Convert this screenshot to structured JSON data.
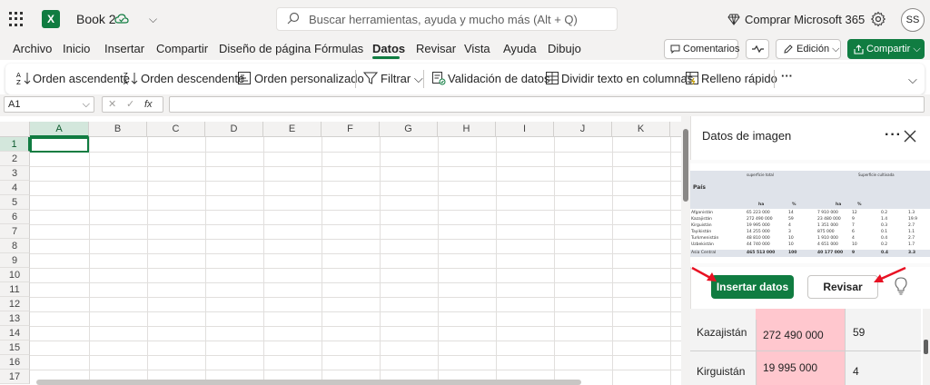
{
  "titlebar": {
    "app_logo": "X",
    "book_title": "Book 2",
    "search_placeholder": "Buscar herramientas, ayuda y mucho más (Alt + Q)",
    "buy_label": "Comprar Microsoft 365",
    "avatar_initials": "SS"
  },
  "tabs": [
    "Archivo",
    "Inicio",
    "Insertar",
    "Compartir",
    "Diseño de página",
    "Fórmulas",
    "Datos",
    "Revisar",
    "Vista",
    "Ayuda",
    "Dibujo"
  ],
  "active_tab": "Datos",
  "topbar": {
    "comments_label": "Comentarios",
    "edit_label": "Edición",
    "share_label": "Compartir"
  },
  "ribbon": {
    "sort_asc": "Orden ascendente",
    "sort_desc": "Orden descendente",
    "sort_custom": "Orden personalizado",
    "filter": "Filtrar",
    "validation": "Validación de datos",
    "text_to_columns": "Dividir texto en columnas",
    "flash_fill": "Relleno rápido",
    "more": "···"
  },
  "formula_bar": {
    "name_box": "A1",
    "cancel": "✕",
    "enter": "✓",
    "fx": "fx"
  },
  "grid": {
    "columns": [
      "A",
      "B",
      "C",
      "D",
      "E",
      "F",
      "G",
      "H",
      "I",
      "J",
      "K"
    ],
    "rows": [
      "1",
      "2",
      "3",
      "4",
      "5",
      "6",
      "7",
      "8",
      "9",
      "10",
      "11",
      "12",
      "13",
      "14",
      "15",
      "16",
      "17"
    ],
    "active_cell": "A1"
  },
  "panel": {
    "title": "Datos de imagen",
    "more": "···",
    "insert_label": "Insertar datos",
    "review_label": "Revisar",
    "rows": [
      {
        "country": "Kazajistán",
        "value": "272 490 000",
        "pct": "59"
      },
      {
        "country": "Kirguistán",
        "value": "19 995 000",
        "pct": "4"
      }
    ]
  },
  "thumbnail": {
    "header_pais": "País",
    "header_superficie": "superficie total",
    "header_cultivada": "Superficie cultivada",
    "unit_ha": "ha",
    "unit_pct": "%",
    "rows": [
      [
        "Afganistán",
        "65 223 000",
        "14",
        "7 910 000",
        "12",
        "0.2",
        "1.3"
      ],
      [
        "Kazajistán",
        "272 490 000",
        "59",
        "23 480 000",
        "9",
        "1.4",
        "19.9"
      ],
      [
        "Kirguistán",
        "19 995 000",
        "4",
        "1 351 000",
        "7",
        "0.3",
        "2.7"
      ],
      [
        "Tayikistán",
        "14 255 000",
        "3",
        "875 000",
        "6",
        "0.1",
        "1.1"
      ],
      [
        "Turkmenistán",
        "48 810 000",
        "10",
        "1 910 000",
        "4",
        "0.4",
        "2.7"
      ],
      [
        "Uzbekistán",
        "44 740 000",
        "10",
        "4 651 000",
        "10",
        "0.2",
        "1.7"
      ],
      [
        "Asia Central",
        "465 513 000",
        "100",
        "40 177 000",
        "9",
        "0.4",
        "3.3"
      ]
    ]
  },
  "colors": {
    "excel_green": "#107c41",
    "error_pink": "#ffc7ce",
    "arrow_red": "#e81123"
  }
}
